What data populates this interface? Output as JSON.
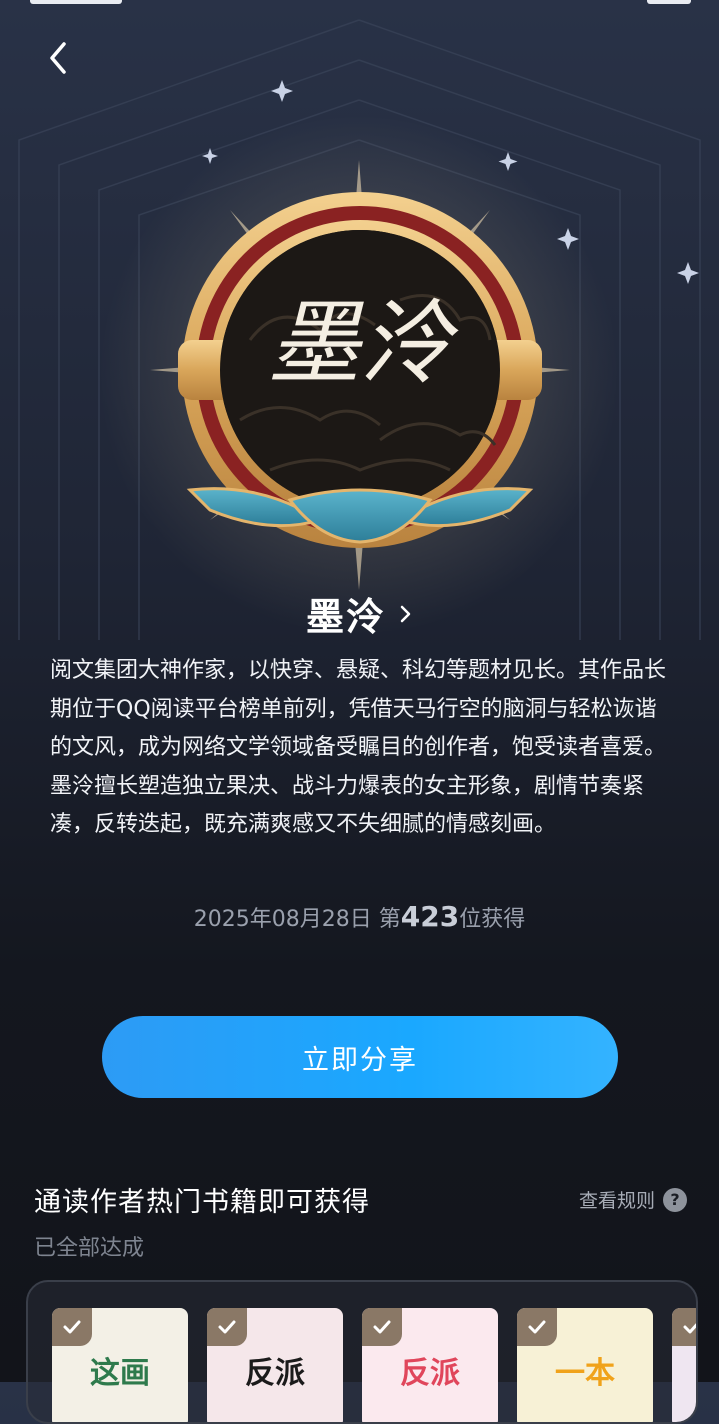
{
  "header": {
    "back_icon": "chevron-left-icon"
  },
  "medal": {
    "calligraphy": "墨泠",
    "colors": {
      "gold": "#e4b56c",
      "dark": "#1c1815",
      "red": "#8a2222",
      "teal": "#3b93ad"
    }
  },
  "author": {
    "name": "墨泠",
    "chevron_icon": "chevron-right-icon"
  },
  "description": [
    "阅文集团大神作家，以快穿、悬疑、科幻等题材见长。其作品长期位于QQ阅读平台榜单前列，凭借天马行空的脑洞与轻松诙谐的文风，成为网络文学领域备受瞩目的创作者，饱受读者喜爱。",
    "墨泠擅长塑造独立果决、战斗力爆表的女主形象，剧情节奏紧凑，反转迭起，既充满爽感又不失细腻的情感刻画。"
  ],
  "earned": {
    "date": "2025年08月28日",
    "prefix": "第",
    "rank": "423",
    "suffix": "位获得"
  },
  "share_button": {
    "label": "立即分享",
    "color": "#1aa8ff"
  },
  "section": {
    "title": "通读作者热门书籍即可获得",
    "rules_label": "查看规则",
    "rules_icon": "question-icon",
    "status": "已全部达成"
  },
  "books": [
    {
      "title": "这画",
      "check_icon": "check-icon",
      "bg": "#f3f0e6",
      "fg": "#2e7a4c"
    },
    {
      "title": "反派",
      "check_icon": "check-icon",
      "bg": "#f5e7ea",
      "fg": "#1b1b1b"
    },
    {
      "title": "反派",
      "check_icon": "check-icon",
      "bg": "#fbe9ee",
      "fg": "#e0465b"
    },
    {
      "title": "一本",
      "check_icon": "check-icon",
      "bg": "#f7f1d6",
      "fg": "#f0a21a"
    },
    {
      "title": "",
      "check_icon": "check-icon",
      "bg": "#efe6f1",
      "fg": "#7a5a8a"
    }
  ]
}
